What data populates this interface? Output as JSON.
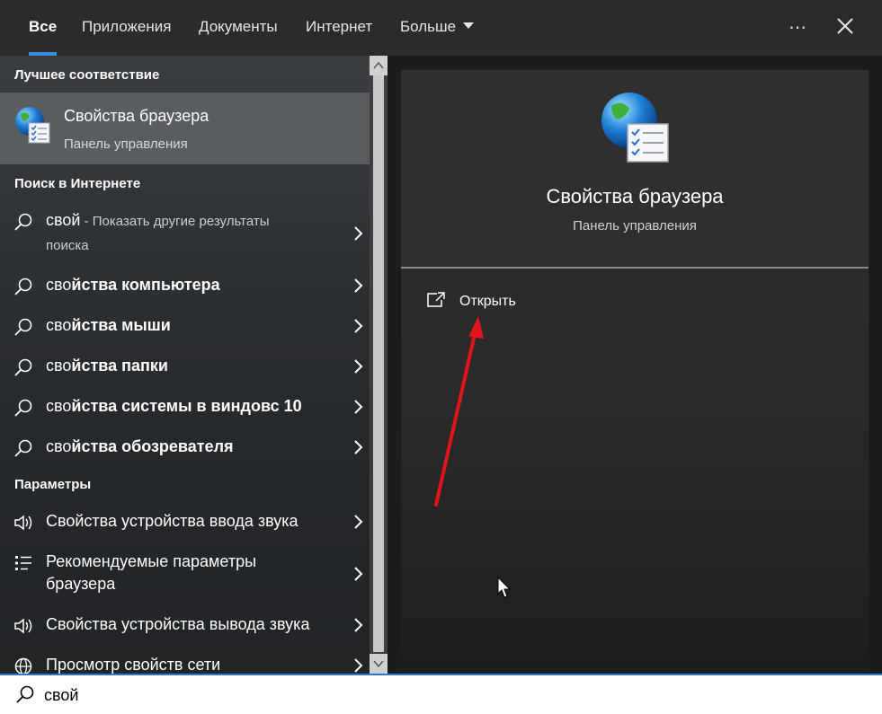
{
  "tabs": [
    {
      "label": "Все",
      "active": true
    },
    {
      "label": "Приложения"
    },
    {
      "label": "Документы"
    },
    {
      "label": "Интернет"
    },
    {
      "label": "Больше"
    }
  ],
  "more_menu_label": "⋯",
  "best_match": {
    "header": "Лучшее соответствие",
    "title": "Свойства браузера",
    "subtitle": "Панель управления",
    "icon": "internet-options-icon"
  },
  "web_search": {
    "header": "Поиск в Интернете",
    "first": {
      "query": "свой",
      "suffix": " - Показать другие результаты",
      "suffix2": "поиска"
    },
    "suggestions": [
      {
        "prefix": "сво",
        "bold": "йства компьютера"
      },
      {
        "prefix": "сво",
        "bold": "йства мыши"
      },
      {
        "prefix": "сво",
        "bold": "йства папки"
      },
      {
        "prefix": "сво",
        "bold": "йства системы в виндовс 10"
      },
      {
        "prefix": "сво",
        "bold": "йства обозревателя"
      }
    ]
  },
  "settings": {
    "header": "Параметры",
    "items": [
      {
        "label": "Свойства устройства ввода звука",
        "icon": "speaker-icon"
      },
      {
        "label": "Рекомендуемые параметры",
        "label2": "браузера",
        "icon": "list-settings-icon"
      },
      {
        "label": "Свойства устройства вывода звука",
        "icon": "speaker-icon"
      },
      {
        "label": "Просмотр свойств сети",
        "icon": "globe-icon"
      }
    ]
  },
  "preview": {
    "title": "Свойства браузера",
    "subtitle": "Панель управления",
    "actions": [
      {
        "label": "Открыть",
        "icon": "open-external-icon"
      }
    ]
  },
  "search": {
    "value": "свой",
    "placeholder": ""
  },
  "colors": {
    "accent": "#3b8ede",
    "annotation_arrow": "#e0151b"
  }
}
